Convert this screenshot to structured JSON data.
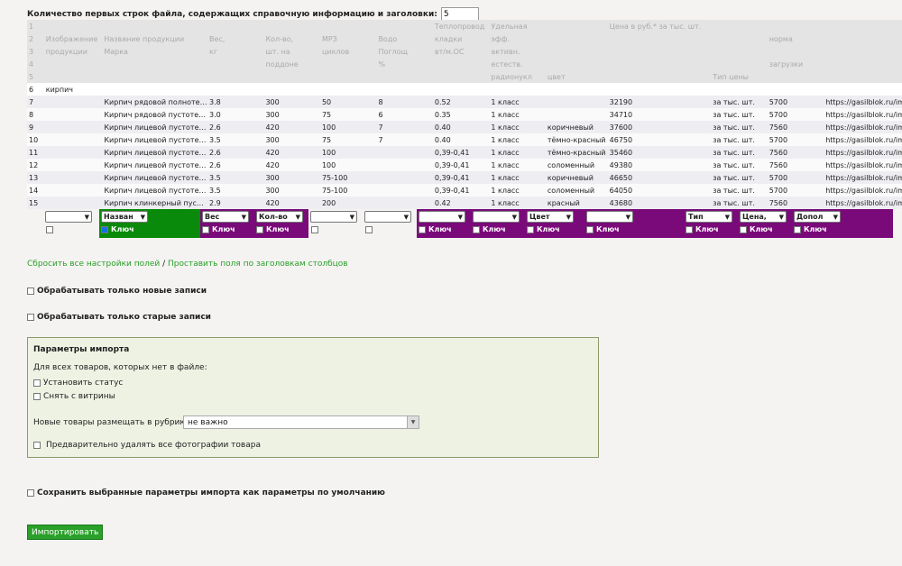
{
  "header": {
    "rows_label": "Количество первых строк файла, содержащих справочную информацию и заголовки:",
    "rows_value": "5"
  },
  "grid": {
    "header_rows": [
      [
        "1",
        "",
        "",
        "",
        "",
        "",
        "",
        "Теплопровод",
        "Удельная",
        "",
        "Цена в руб.* за тыс. шт.",
        "",
        "",
        ""
      ],
      [
        "2",
        "Изображение",
        "Название продукции",
        "Вес,",
        "Кол-во,",
        "МРЗ",
        "Водо",
        "кладки",
        "эфф.",
        "",
        "",
        "",
        "норма",
        ""
      ],
      [
        "3",
        "продукции",
        "Марка",
        "кг",
        "шт. на",
        "циклов",
        "Поглощ",
        "вт/м.ОС",
        "активн.",
        "",
        "",
        "",
        "",
        ""
      ],
      [
        "4",
        "",
        "",
        "",
        "поддоне",
        "",
        "%",
        "",
        "естеств.",
        "",
        "",
        "",
        "загрузки",
        ""
      ],
      [
        "5",
        "",
        "",
        "",
        "",
        "",
        "",
        "",
        "радионукл",
        "цвет",
        "",
        "Тип цены",
        "",
        ""
      ]
    ],
    "section_row": [
      "6",
      "кирпич"
    ],
    "data_rows": [
      [
        "7",
        "",
        "Кирпич рядовой полнотелый",
        "3.8",
        "300",
        "50",
        "8",
        "0.52",
        "1 класс",
        "",
        "32190",
        "за тыс. шт.",
        "5700",
        "https://gasilblok.ru/img/..."
      ],
      [
        "8",
        "",
        "Кирпич рядовой пустотелый",
        "3.0",
        "300",
        "75",
        "6",
        "0.35",
        "1 класс",
        "",
        "34710",
        "за тыс. шт.",
        "5700",
        "https://gasilblok.ru/img/..."
      ],
      [
        "9",
        "",
        "Кирпич лицевой пустотелый",
        "2.6",
        "420",
        "100",
        "7",
        "0.40",
        "1 класс",
        "коричневый",
        "37600",
        "за тыс. шт.",
        "7560",
        "https://gasilblok.ru/img/..."
      ],
      [
        "10",
        "",
        "Кирпич лицевой пустотелый",
        "3.5",
        "300",
        "75",
        "7",
        "0.40",
        "1 класс",
        "тёмно-красный",
        "46750",
        "за тыс. шт.",
        "5700",
        "https://gasilblok.ru/img/..."
      ],
      [
        "11",
        "",
        "Кирпич лицевой пустотелый",
        "2.6",
        "420",
        "100",
        "",
        "0,39-0,41",
        "1 класс",
        "тёмно-красный",
        "35460",
        "за тыс. шт.",
        "7560",
        "https://gasilblok.ru/img/..."
      ],
      [
        "12",
        "",
        "Кирпич лицевой пустотелый",
        "2.6",
        "420",
        "100",
        "",
        "0,39-0,41",
        "1 класс",
        "соломенный",
        "49380",
        "за тыс. шт.",
        "7560",
        "https://gasilblok.ru/img/..."
      ],
      [
        "13",
        "",
        "Кирпич лицевой пустотелый",
        "3.5",
        "300",
        "75-100",
        "",
        "0,39-0,41",
        "1 класс",
        "коричневый",
        "46650",
        "за тыс. шт.",
        "5700",
        "https://gasilblok.ru/img/..."
      ],
      [
        "14",
        "",
        "Кирпич лицевой пустотелый",
        "3.5",
        "300",
        "75-100",
        "",
        "0,39-0,41",
        "1 класс",
        "соломенный",
        "64050",
        "за тыс. шт.",
        "5700",
        "https://gasilblok.ru/img/..."
      ],
      [
        "15",
        "",
        "Кирпич клинкерный пустотелый",
        "2.9",
        "420",
        "200",
        "",
        "0.42",
        "1 класс",
        "красный",
        "43680",
        "за тыс. шт.",
        "7560",
        "https://gasilblok.ru/img/..."
      ]
    ]
  },
  "field_selectors": [
    {
      "label": "",
      "theme": "none",
      "has_key": false
    },
    {
      "label": "Назван",
      "theme": "green",
      "has_key": true,
      "key_checked": true
    },
    {
      "label": "Вес",
      "theme": "purple",
      "has_key": true,
      "key_checked": false
    },
    {
      "label": "Кол-во",
      "theme": "purple",
      "has_key": true,
      "key_checked": false
    },
    {
      "label": "",
      "theme": "none",
      "has_key": false
    },
    {
      "label": "",
      "theme": "none",
      "has_key": false
    },
    {
      "label": "",
      "theme": "purple",
      "has_key": true,
      "key_checked": false
    },
    {
      "label": "",
      "theme": "purple",
      "has_key": true,
      "key_checked": false
    },
    {
      "label": "Цвет",
      "theme": "purple",
      "has_key": true,
      "key_checked": false
    },
    {
      "label": "",
      "theme": "purple",
      "has_key": true,
      "key_checked": false
    },
    {
      "label": "Тип",
      "theme": "purple",
      "has_key": true,
      "key_checked": false
    },
    {
      "label": "Цена,",
      "theme": "purple",
      "has_key": true,
      "key_checked": false
    },
    {
      "label": "Допол",
      "theme": "purple",
      "has_key": true,
      "key_checked": false
    }
  ],
  "key_label": "Ключ",
  "links": {
    "reset": "Сбросить все настройки полей",
    "separator": " / ",
    "auto": "Проставить поля по заголовкам столбцов"
  },
  "options": {
    "only_new": "Обрабатывать только новые записи",
    "only_old": "Обрабатывать только старые записи",
    "save_default": "Сохранить выбранные параметры импорта как параметры по умолчанию"
  },
  "import_params": {
    "title": "Параметры импорта",
    "missing_label": "Для всех товаров, которых нет в файле:",
    "set_status": "Установить статус",
    "remove_showcase": "Снять с витрины",
    "rubric_label": "Новые товары размещать в рубрике:",
    "rubric_value": "не важно",
    "delete_photos": "Предварительно удалять все фотографии товара"
  },
  "import_button": "Импортировать",
  "colors": {
    "green": "#0a8a0a",
    "purple": "#7a0a7a",
    "link": "#2aa02a"
  }
}
